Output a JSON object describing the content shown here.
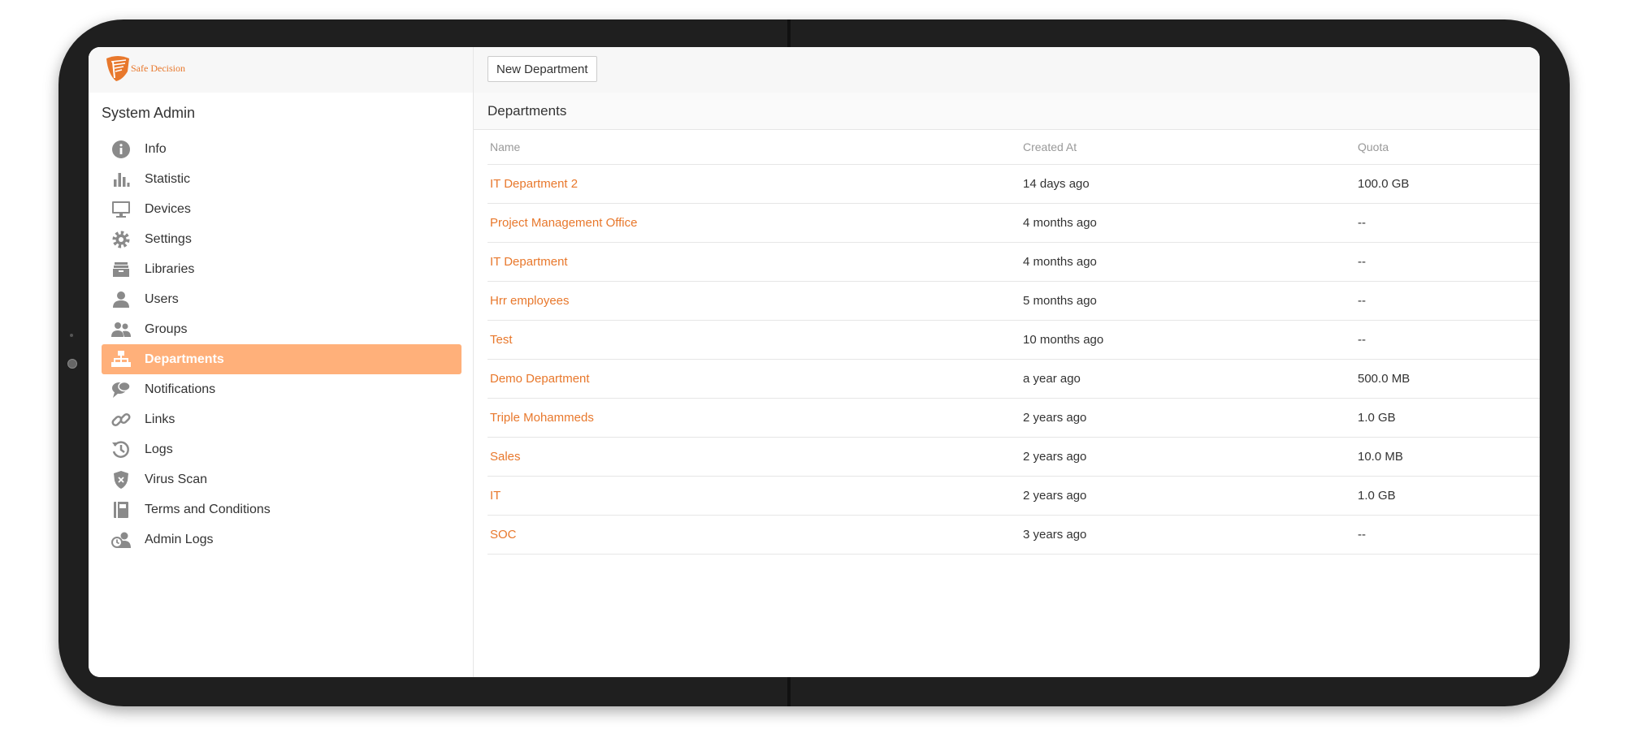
{
  "brand": {
    "name": "Safe Decision",
    "color": "#e8782c"
  },
  "sidebar": {
    "title": "System Admin",
    "items": [
      {
        "label": "Info",
        "icon": "info-icon",
        "active": false
      },
      {
        "label": "Statistic",
        "icon": "bar-chart-icon",
        "active": false
      },
      {
        "label": "Devices",
        "icon": "monitor-icon",
        "active": false
      },
      {
        "label": "Settings",
        "icon": "gear-icon",
        "active": false
      },
      {
        "label": "Libraries",
        "icon": "archive-icon",
        "active": false
      },
      {
        "label": "Users",
        "icon": "user-icon",
        "active": false
      },
      {
        "label": "Groups",
        "icon": "users-icon",
        "active": false
      },
      {
        "label": "Departments",
        "icon": "sitemap-icon",
        "active": true
      },
      {
        "label": "Notifications",
        "icon": "chat-bubbles-icon",
        "active": false
      },
      {
        "label": "Links",
        "icon": "link-icon",
        "active": false
      },
      {
        "label": "Logs",
        "icon": "history-icon",
        "active": false
      },
      {
        "label": "Virus Scan",
        "icon": "shield-icon",
        "active": false
      },
      {
        "label": "Terms and Conditions",
        "icon": "book-icon",
        "active": false
      },
      {
        "label": "Admin Logs",
        "icon": "admin-logs-icon",
        "active": false
      }
    ]
  },
  "toolbar": {
    "new_department_label": "New Department"
  },
  "main": {
    "section_title": "Departments",
    "columns": {
      "name": "Name",
      "created": "Created At",
      "quota": "Quota"
    },
    "rows": [
      {
        "name": "IT Department 2",
        "created": "14 days ago",
        "quota": "100.0 GB"
      },
      {
        "name": "Project Management Office",
        "created": "4 months ago",
        "quota": "--"
      },
      {
        "name": "IT Department",
        "created": "4 months ago",
        "quota": "--"
      },
      {
        "name": "Hrr employees",
        "created": "5 months ago",
        "quota": "--"
      },
      {
        "name": "Test",
        "created": "10 months ago",
        "quota": "--"
      },
      {
        "name": "Demo Department",
        "created": "a year ago",
        "quota": "500.0 MB"
      },
      {
        "name": "Triple Mohammeds",
        "created": "2 years ago",
        "quota": "1.0 GB"
      },
      {
        "name": "Sales",
        "created": "2 years ago",
        "quota": "10.0 MB"
      },
      {
        "name": "IT",
        "created": "2 years ago",
        "quota": "1.0 GB"
      },
      {
        "name": "SOC",
        "created": "3 years ago",
        "quota": "--"
      }
    ]
  },
  "colors": {
    "accent": "#e8782c",
    "active_bg": "#ffb07a",
    "icon_gray": "#8a8a8a"
  }
}
